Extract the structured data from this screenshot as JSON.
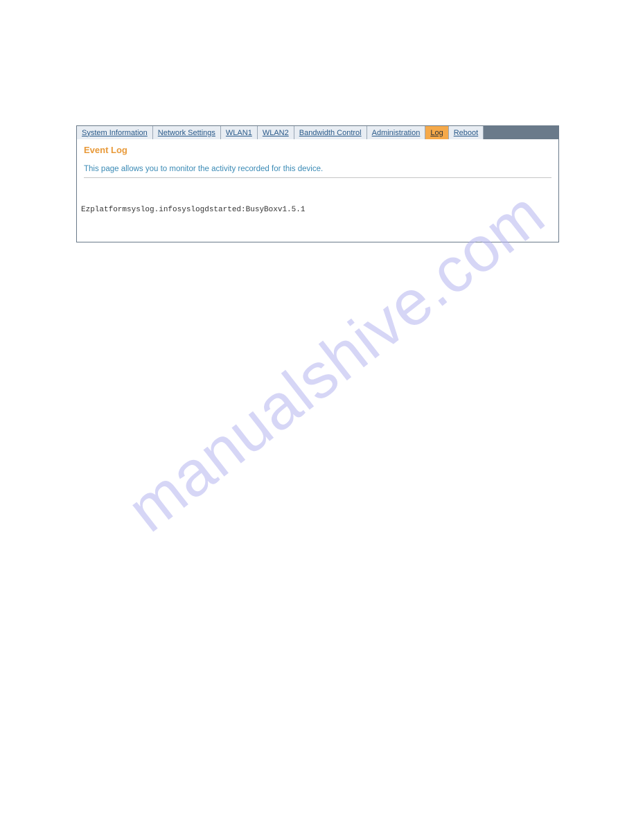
{
  "tabs": [
    {
      "label": "System Information",
      "active": false
    },
    {
      "label": "Network Settings",
      "active": false
    },
    {
      "label": "WLAN1",
      "active": false
    },
    {
      "label": "WLAN2",
      "active": false
    },
    {
      "label": "Bandwidth Control",
      "active": false
    },
    {
      "label": "Administration",
      "active": false
    },
    {
      "label": "Log",
      "active": true
    },
    {
      "label": "Reboot",
      "active": false
    }
  ],
  "page": {
    "title": "Event Log",
    "description": "This page allows you to monitor the activity recorded for this device."
  },
  "log": {
    "entry": "Ezplatformsyslog.infosyslogdstarted:BusyBoxv1.5.1"
  },
  "watermark": "manualshive.com"
}
